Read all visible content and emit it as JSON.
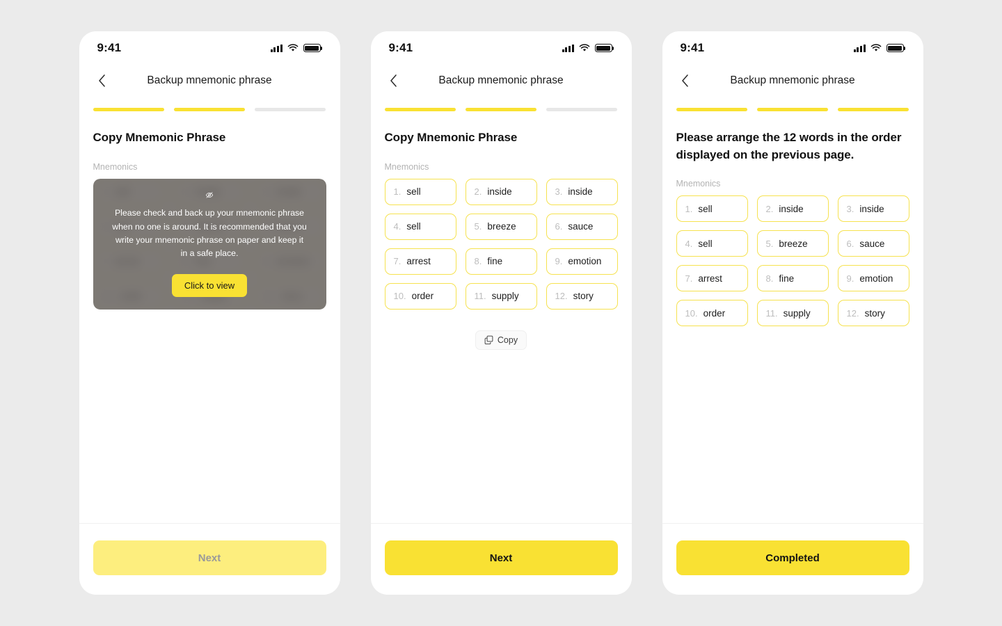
{
  "theme": {
    "accent": "#f9e133",
    "accent_disabled": "#fdee7e",
    "chip_border": "#f6e24f",
    "page_background": "#ebebeb",
    "phone_background": "#ffffff",
    "mask_overlay": "#5d5854"
  },
  "status_bar": {
    "time": "9:41",
    "signal_icon": "cellular-signal-icon",
    "wifi_icon": "wifi-icon",
    "battery_icon": "battery-full-icon"
  },
  "nav": {
    "back_icon": "chevron-left-icon",
    "title": "Backup mnemonic phrase"
  },
  "mnemonics_label": "Mnemonics",
  "words": [
    {
      "index": "1.",
      "word": "sell"
    },
    {
      "index": "2.",
      "word": "inside"
    },
    {
      "index": "3.",
      "word": "inside"
    },
    {
      "index": "4.",
      "word": "sell"
    },
    {
      "index": "5.",
      "word": "breeze"
    },
    {
      "index": "6.",
      "word": "sauce"
    },
    {
      "index": "7.",
      "word": "arrest"
    },
    {
      "index": "8.",
      "word": "fine"
    },
    {
      "index": "9.",
      "word": "emotion"
    },
    {
      "index": "10.",
      "word": "order"
    },
    {
      "index": "11.",
      "word": "supply"
    },
    {
      "index": "12.",
      "word": "story"
    }
  ],
  "screens": [
    {
      "id": "screen-hidden-mnemonics",
      "progress": {
        "total": 3,
        "completed": 2
      },
      "heading": "Copy Mnemonic Phrase",
      "mask": {
        "eye_icon": "eye-off-icon",
        "message": "Please check and back up your mnemonic phrase when no one is around. It is recommended that you write your mnemonic phrase on paper and keep it in a safe place.",
        "button_label": "Click to view"
      },
      "cta": {
        "label": "Next",
        "disabled": true
      }
    },
    {
      "id": "screen-revealed-mnemonics",
      "progress": {
        "total": 3,
        "completed": 2
      },
      "heading": "Copy Mnemonic Phrase",
      "copy_button": {
        "label": "Copy",
        "icon": "copy-icon"
      },
      "cta": {
        "label": "Next",
        "disabled": false
      }
    },
    {
      "id": "screen-verify-mnemonics",
      "progress": {
        "total": 3,
        "completed": 3
      },
      "heading": "Please arrange the 12 words in the order displayed on the previous page.",
      "cta": {
        "label": "Completed",
        "disabled": false
      }
    }
  ]
}
